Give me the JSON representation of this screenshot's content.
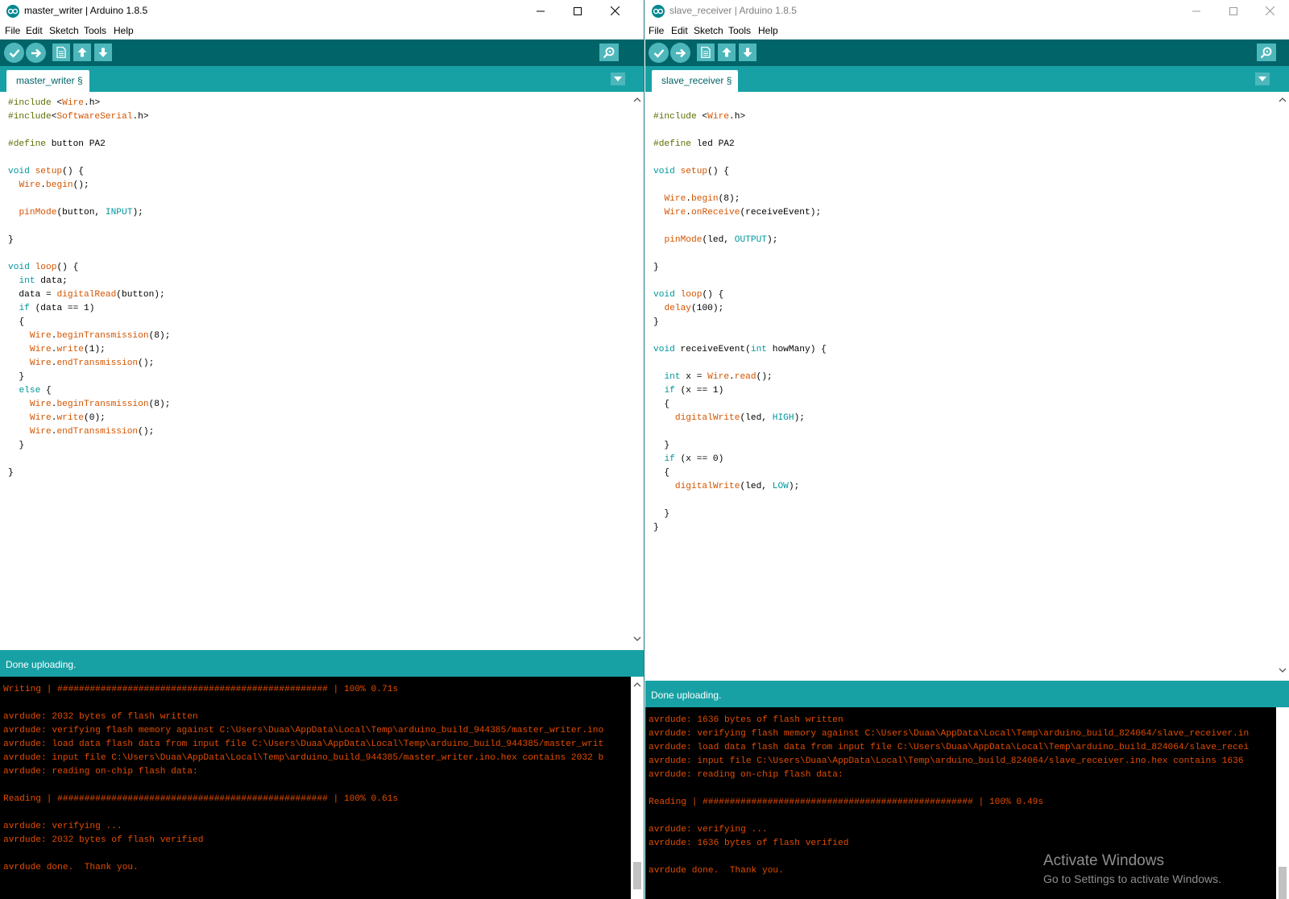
{
  "windows": [
    {
      "id": "master",
      "title": "master_writer | Arduino 1.8.5",
      "menu": [
        "File",
        "Edit",
        "Sketch",
        "Tools",
        "Help"
      ],
      "toolbar": [
        "verify-icon",
        "upload-icon",
        "new-icon",
        "open-icon",
        "save-icon",
        "serial-monitor-icon"
      ],
      "tab": "master_writer §",
      "status": "Done uploading.",
      "code": [
        "#include <Wire.h>",
        "#include<SoftwareSerial.h>",
        "",
        "#define button PA2",
        "",
        "void setup() {",
        "  Wire.begin();",
        "",
        "  pinMode(button, INPUT);",
        "",
        "}",
        "",
        "void loop() {",
        "  int data;",
        "  data = digitalRead(button);",
        "  if (data == 1)",
        "  {",
        "    Wire.beginTransmission(8);",
        "    Wire.write(1);",
        "    Wire.endTransmission();",
        "  }",
        "  else {",
        "    Wire.beginTransmission(8);",
        "    Wire.write(0);",
        "    Wire.endTransmission();",
        "  }",
        "",
        "}"
      ],
      "console": [
        "Writing | ################################################## | 100% 0.71s",
        "",
        "avrdude: 2032 bytes of flash written",
        "avrdude: verifying flash memory against C:\\Users\\Duaa\\AppData\\Local\\Temp\\arduino_build_944385/master_writer.ino",
        "avrdude: load data flash data from input file C:\\Users\\Duaa\\AppData\\Local\\Temp\\arduino_build_944385/master_writ",
        "avrdude: input file C:\\Users\\Duaa\\AppData\\Local\\Temp\\arduino_build_944385/master_writer.ino.hex contains 2032 b",
        "avrdude: reading on-chip flash data:",
        "",
        "Reading | ################################################## | 100% 0.61s",
        "",
        "avrdude: verifying ...",
        "avrdude: 2032 bytes of flash verified",
        "",
        "avrdude done.  Thank you."
      ]
    },
    {
      "id": "slave",
      "title": "slave_receiver | Arduino 1.8.5",
      "menu": [
        "File",
        "Edit",
        "Sketch",
        "Tools",
        "Help"
      ],
      "toolbar": [
        "verify-icon",
        "upload-icon",
        "new-icon",
        "open-icon",
        "save-icon",
        "serial-monitor-icon"
      ],
      "tab": "slave_receiver §",
      "status": "Done uploading.",
      "code": [
        "",
        "#include <Wire.h>",
        "",
        "#define led PA2",
        "",
        "void setup() {",
        "",
        "  Wire.begin(8);",
        "  Wire.onReceive(receiveEvent);",
        "",
        "  pinMode(led, OUTPUT);",
        "",
        "}",
        "",
        "void loop() {",
        "  delay(100);",
        "}",
        "",
        "void receiveEvent(int howMany) {",
        "",
        "  int x = Wire.read();",
        "  if (x == 1)",
        "  {",
        "    digitalWrite(led, HIGH);",
        "",
        "  }",
        "  if (x == 0)",
        "  {",
        "    digitalWrite(led, LOW);",
        "",
        "  }",
        "}"
      ],
      "console": [
        "avrdude: 1636 bytes of flash written",
        "avrdude: verifying flash memory against C:\\Users\\Duaa\\AppData\\Local\\Temp\\arduino_build_824064/slave_receiver.in",
        "avrdude: load data flash data from input file C:\\Users\\Duaa\\AppData\\Local\\Temp\\arduino_build_824064/slave_recei",
        "avrdude: input file C:\\Users\\Duaa\\AppData\\Local\\Temp\\arduino_build_824064/slave_receiver.ino.hex contains 1636",
        "avrdude: reading on-chip flash data:",
        "",
        "Reading | ################################################## | 100% 0.49s",
        "",
        "avrdude: verifying ...",
        "avrdude: 1636 bytes of flash verified",
        "",
        "avrdude done.  Thank you."
      ]
    }
  ],
  "watermark": {
    "line1": "Activate Windows",
    "line2": "Go to Settings to activate Windows."
  },
  "colors": {
    "teal_dark": "#006468",
    "teal_tab": "#17a1a5",
    "button": "#4db7bb",
    "console_text": "#e34c00",
    "keyword": "#00979c",
    "function": "#d35400",
    "preprocessor": "#5e6d03"
  }
}
